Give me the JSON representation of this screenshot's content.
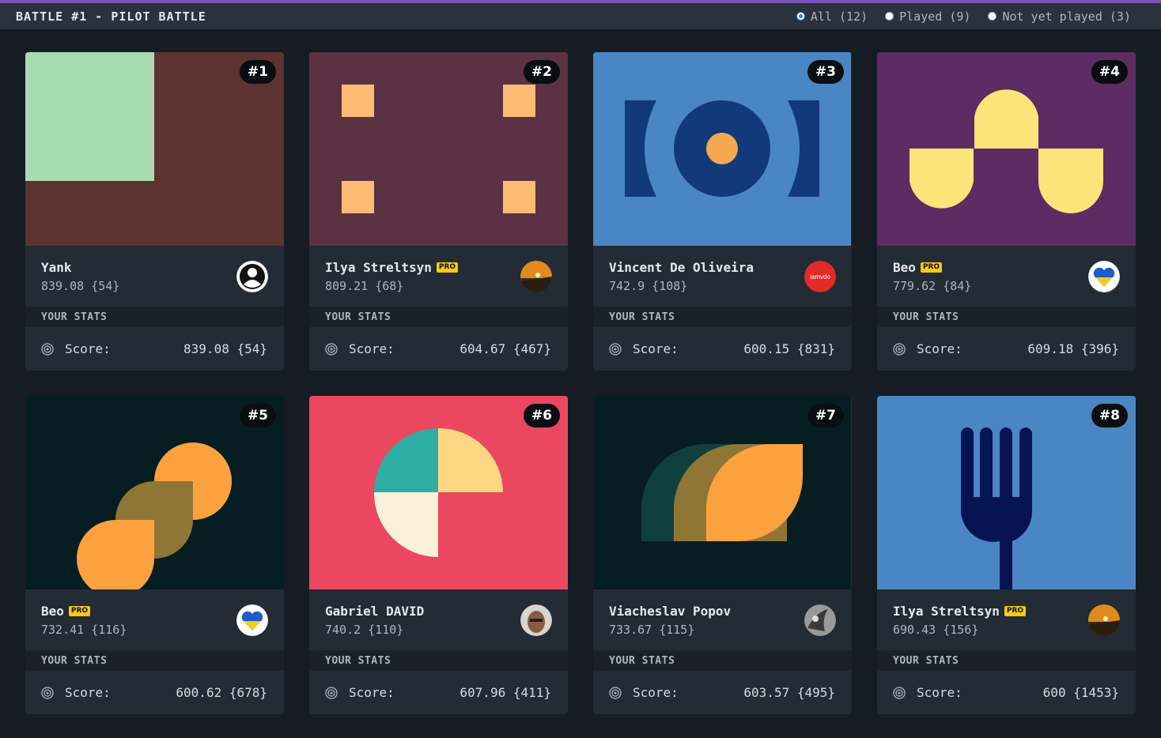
{
  "header": {
    "title": "BATTLE #1 - PILOT BATTLE",
    "filters": [
      {
        "label": "All (12)",
        "checked": true
      },
      {
        "label": "Played (9)",
        "checked": false
      },
      {
        "label": "Not yet played (3)",
        "checked": false
      }
    ]
  },
  "cards": [
    {
      "rank": "#1",
      "name": "Yank",
      "pro": false,
      "score": "839.08 {54}",
      "stats_label": "YOUR STATS",
      "score_label": "Score:",
      "your_score": "839.08 {54}",
      "avatar": "person-avatar"
    },
    {
      "rank": "#2",
      "name": "Ilya Streltsyn",
      "pro": true,
      "pro_label": "PRO",
      "score": "809.21 {68}",
      "stats_label": "YOUR STATS",
      "score_label": "Score:",
      "your_score": "604.67 {467}",
      "avatar": "landscape-avatar"
    },
    {
      "rank": "#3",
      "name": "Vincent De Oliveira",
      "pro": false,
      "score": "742.9 {108}",
      "stats_label": "YOUR STATS",
      "score_label": "Score:",
      "your_score": "600.15 {831}",
      "avatar": "iamvdo-avatar",
      "avatar_text": "iamvdo"
    },
    {
      "rank": "#4",
      "name": "Beo",
      "pro": true,
      "pro_label": "PRO",
      "score": "779.62 {84}",
      "stats_label": "YOUR STATS",
      "score_label": "Score:",
      "your_score": "609.18 {396}",
      "avatar": "heart-avatar"
    },
    {
      "rank": "#5",
      "name": "Beo",
      "pro": true,
      "pro_label": "PRO",
      "score": "732.41 {116}",
      "stats_label": "YOUR STATS",
      "score_label": "Score:",
      "your_score": "600.62 {678}",
      "avatar": "heart-avatar"
    },
    {
      "rank": "#6",
      "name": "Gabriel DAVID",
      "pro": false,
      "score": "740.2 {110}",
      "stats_label": "YOUR STATS",
      "score_label": "Score:",
      "your_score": "607.96 {411}",
      "avatar": "photo-avatar"
    },
    {
      "rank": "#7",
      "name": "Viacheslav Popov",
      "pro": false,
      "score": "733.67 {115}",
      "stats_label": "YOUR STATS",
      "score_label": "Score:",
      "your_score": "603.57 {495}",
      "avatar": "bw-photo-avatar"
    },
    {
      "rank": "#8",
      "name": "Ilya Streltsyn",
      "pro": true,
      "pro_label": "PRO",
      "score": "690.43 {156}",
      "stats_label": "YOUR STATS",
      "score_label": "Score:",
      "your_score": "600 {1453}",
      "avatar": "landscape-avatar"
    }
  ]
}
